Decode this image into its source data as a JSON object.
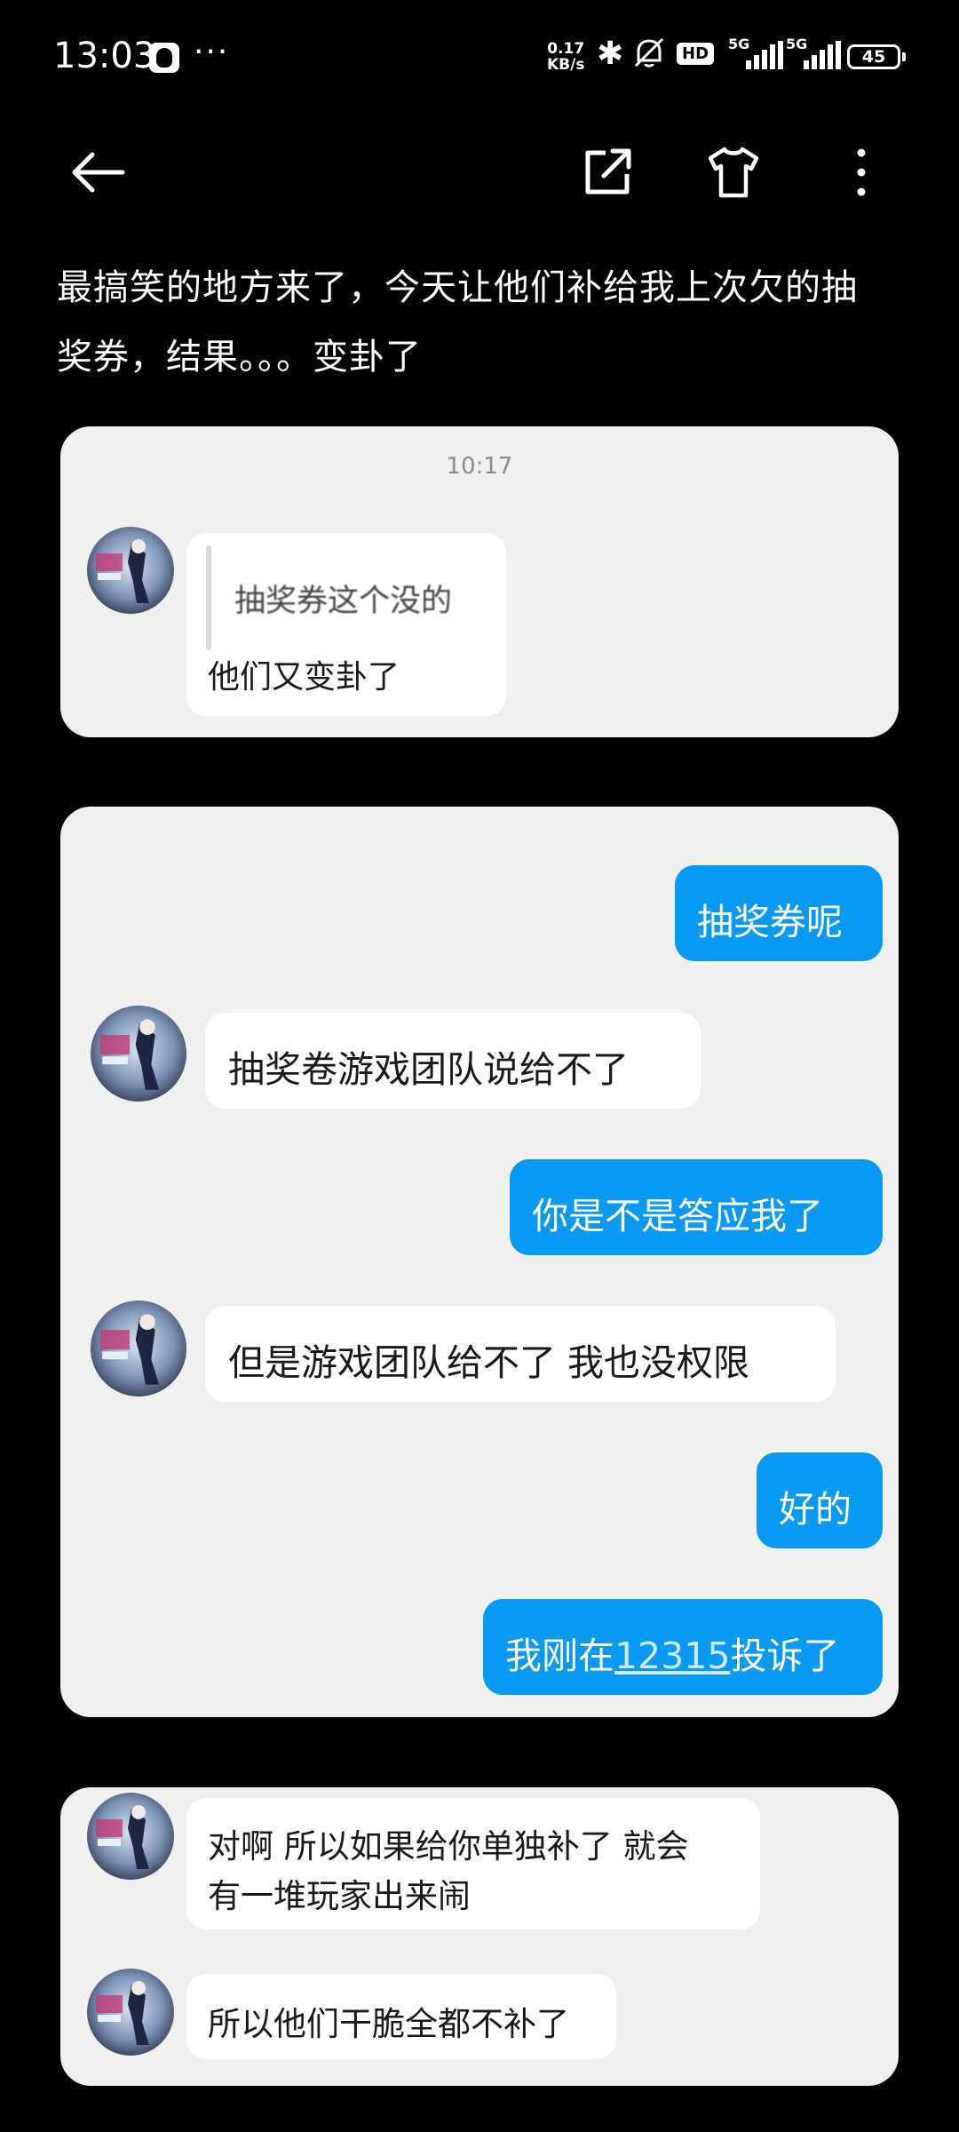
{
  "status_bar": {
    "time": "13:03",
    "more": "···",
    "speed_value": "0.17",
    "speed_unit": "KB/s",
    "hd": "HD",
    "signal1": "5G",
    "signal2": "5G",
    "battery": "45"
  },
  "post": {
    "text_line1": "最搞笑的地方来了，今天让他们补给我上次欠的抽",
    "text_line2": "奖券，结果。。。变卦了"
  },
  "screenshot1": {
    "timestamp": "10:17",
    "quote": "抽奖券这个没的",
    "message": "他们又变卦了"
  },
  "screenshot2": {
    "messages": [
      {
        "side": "right",
        "text": "抽奖券呢"
      },
      {
        "side": "left",
        "text": "抽奖卷游戏团队说给不了"
      },
      {
        "side": "right",
        "text": "你是不是答应我了"
      },
      {
        "side": "left",
        "text": "但是游戏团队给不了 我也没权限"
      },
      {
        "side": "right",
        "text": "好的"
      },
      {
        "side": "right",
        "text_before": "我刚在",
        "link": "12315",
        "text_after": "投诉了"
      }
    ]
  },
  "screenshot3": {
    "msg1_line1": "对啊 所以如果给你单独补了 就会",
    "msg1_line2": "有一堆玩家出来闹",
    "msg2": "所以他们干脆全都不补了"
  },
  "colors": {
    "background": "#000000",
    "card": "#f0f0f0",
    "bubble_blue": "#0899f5",
    "bubble_white": "#ffffff"
  },
  "icons": [
    "back-arrow-icon",
    "share-icon",
    "tshirt-icon",
    "more-vertical-icon",
    "qq-icon",
    "bluetooth-icon",
    "mute-icon"
  ]
}
